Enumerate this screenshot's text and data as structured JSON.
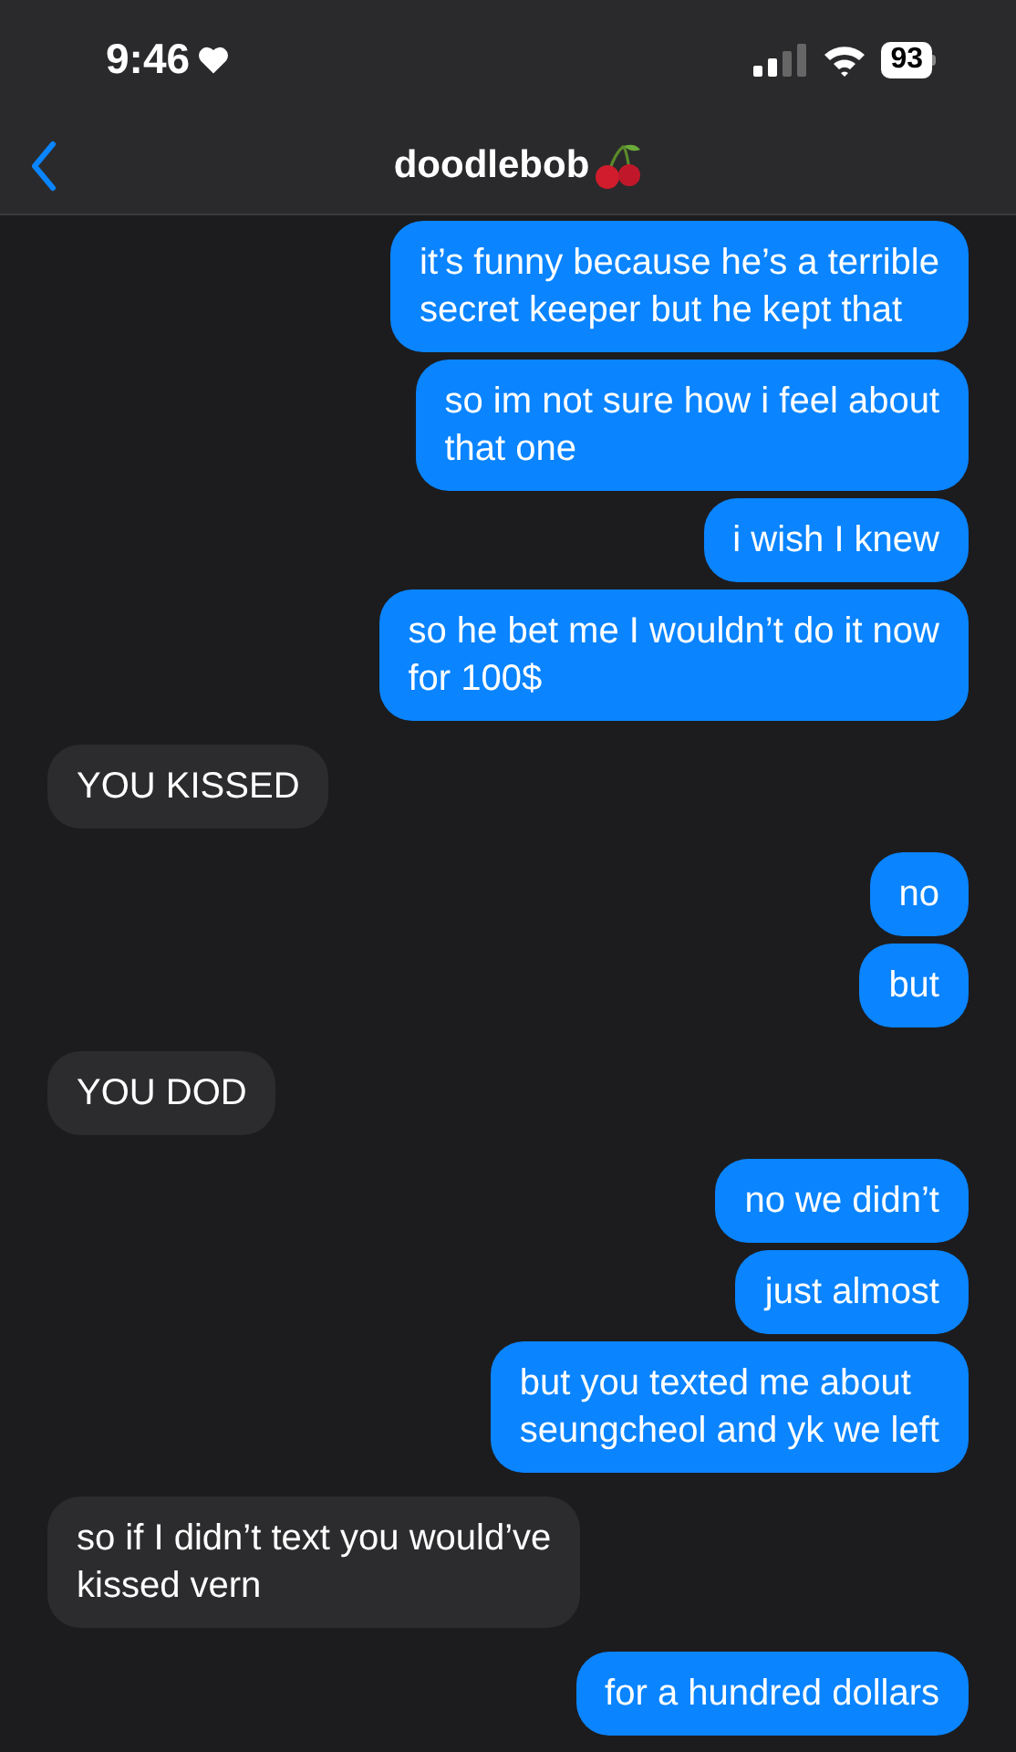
{
  "status_bar": {
    "time": "9:46",
    "battery": "93"
  },
  "header": {
    "contact": "doodlebob"
  },
  "messages": [
    {
      "kind": "sent",
      "lines": [
        "it’s funny because he’s a terrible",
        "secret keeper but he kept that"
      ]
    },
    {
      "kind": "sent",
      "lines": [
        "so im not sure how i feel about",
        "that one"
      ]
    },
    {
      "kind": "sent",
      "lines": [
        "i wish I knew"
      ]
    },
    {
      "kind": "sent",
      "lines": [
        "so he bet me I wouldn’t do it now",
        "for 100$"
      ]
    },
    {
      "kind": "received",
      "lines": [
        "YOU KISSED"
      ]
    },
    {
      "kind": "sent",
      "lines": [
        "no"
      ]
    },
    {
      "kind": "sent",
      "lines": [
        "but"
      ]
    },
    {
      "kind": "received",
      "lines": [
        "YOU DOD"
      ]
    },
    {
      "kind": "sent",
      "lines": [
        "no we didn’t"
      ]
    },
    {
      "kind": "sent",
      "lines": [
        "just almost"
      ]
    },
    {
      "kind": "sent",
      "lines": [
        "but you texted me about",
        "seungcheol and yk we left"
      ]
    },
    {
      "kind": "received",
      "lines": [
        "so if I didn’t text you would’ve",
        "kissed vern"
      ]
    },
    {
      "kind": "sent",
      "lines": [
        "for a hundred dollars"
      ]
    }
  ]
}
